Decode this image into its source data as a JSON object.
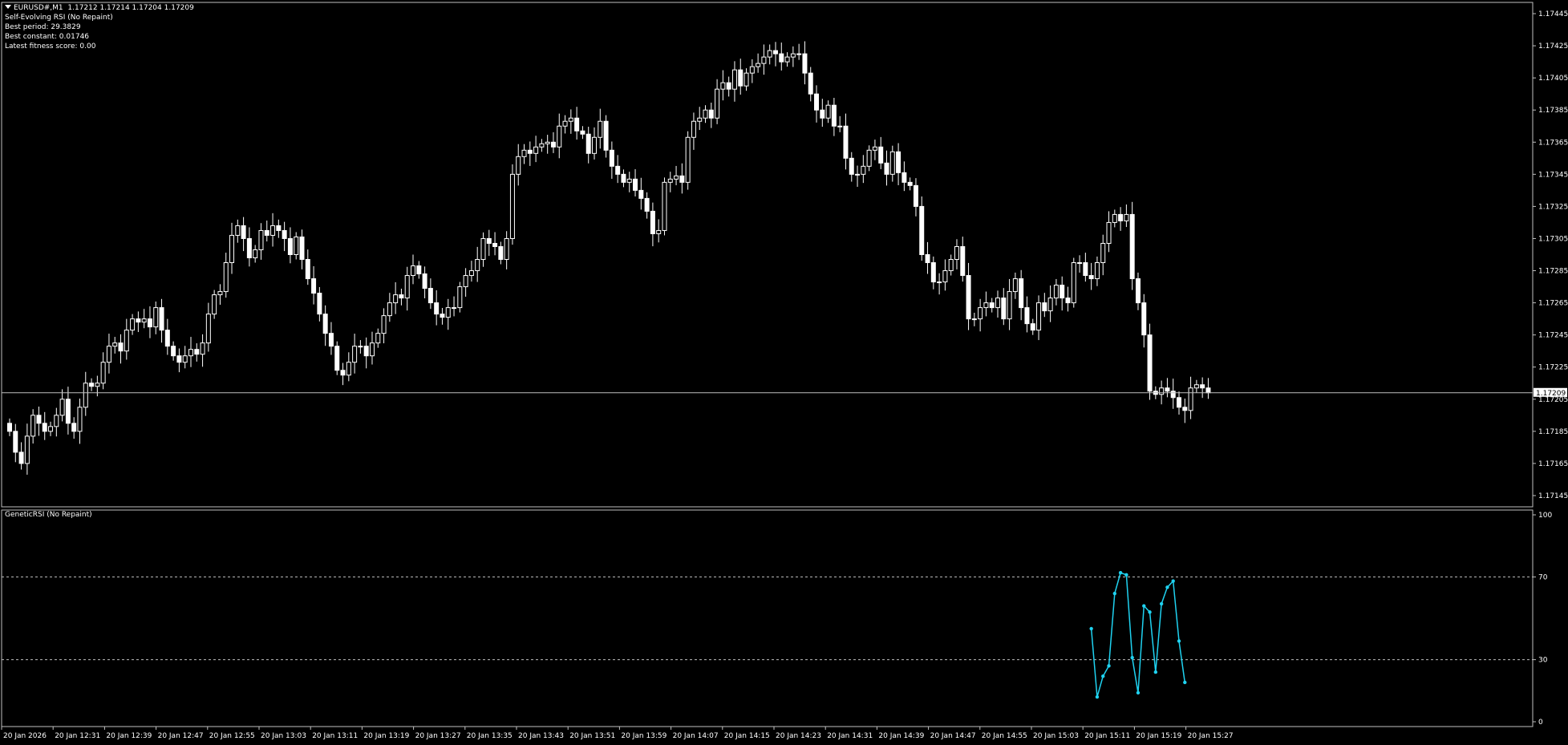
{
  "header": {
    "symbol": "EURUSD#,M1",
    "ohlc": "1.17212 1.17214 1.17204 1.17209",
    "indicator": "Self-Evolving RSI (No Repaint)",
    "best_period": "Best period: 29.3829",
    "best_constant": "Best constant: 0.01746",
    "fitness": "Latest fitness score: 0.00"
  },
  "subwindow": {
    "title": "GeneticRSI (No Repaint)"
  },
  "colors": {
    "background": "#000000",
    "bull": "#ffffff",
    "bear": "#ffffff",
    "indicator_line": "#1fd2f0",
    "level": "#c0c0c0"
  },
  "price_axis": {
    "min": 1.1714,
    "max": 1.1745,
    "ticks": [
      "1.17445",
      "1.17425",
      "1.17405",
      "1.17385",
      "1.17365",
      "1.17345",
      "1.17325",
      "1.17305",
      "1.17285",
      "1.17265",
      "1.17245",
      "1.17225",
      "1.17205",
      "1.17185",
      "1.17165",
      "1.17145"
    ],
    "current_price": "1.17209"
  },
  "time_axis": {
    "labels": [
      "20 Jan 2026",
      "20 Jan 12:31",
      "20 Jan 12:39",
      "20 Jan 12:47",
      "20 Jan 12:55",
      "20 Jan 13:03",
      "20 Jan 13:11",
      "20 Jan 13:19",
      "20 Jan 13:27",
      "20 Jan 13:35",
      "20 Jan 13:43",
      "20 Jan 13:51",
      "20 Jan 13:59",
      "20 Jan 14:07",
      "20 Jan 14:15",
      "20 Jan 14:23",
      "20 Jan 14:31",
      "20 Jan 14:39",
      "20 Jan 14:47",
      "20 Jan 14:55",
      "20 Jan 15:03",
      "20 Jan 15:11",
      "20 Jan 15:19",
      "20 Jan 15:27"
    ]
  },
  "indicator_axis": {
    "min": 0,
    "max": 100,
    "ticks": [
      "100",
      "70",
      "30",
      "0"
    ],
    "levels": [
      70,
      30
    ]
  },
  "chart_data": {
    "type": "candlestick",
    "closes": [
      1.17185,
      1.17172,
      1.17165,
      1.17182,
      1.17195,
      1.1719,
      1.17185,
      1.17188,
      1.17195,
      1.17205,
      1.1719,
      1.17185,
      1.172,
      1.17215,
      1.17213,
      1.17215,
      1.17228,
      1.17238,
      1.1724,
      1.17235,
      1.17248,
      1.17255,
      1.17253,
      1.17255,
      1.1725,
      1.17262,
      1.17248,
      1.17238,
      1.17232,
      1.17228,
      1.17232,
      1.17236,
      1.17233,
      1.1724,
      1.17258,
      1.1727,
      1.17272,
      1.1729,
      1.17307,
      1.17313,
      1.17305,
      1.17293,
      1.17298,
      1.1731,
      1.17307,
      1.17313,
      1.1731,
      1.17305,
      1.17295,
      1.17306,
      1.17292,
      1.1728,
      1.17271,
      1.17258,
      1.17246,
      1.17238,
      1.17223,
      1.1722,
      1.17228,
      1.17238,
      1.17238,
      1.17232,
      1.1724,
      1.17246,
      1.17257,
      1.17265,
      1.1727,
      1.17268,
      1.17282,
      1.17288,
      1.17283,
      1.17274,
      1.17265,
      1.17258,
      1.17256,
      1.17262,
      1.17262,
      1.17275,
      1.17282,
      1.17285,
      1.17292,
      1.17305,
      1.17302,
      1.173,
      1.17292,
      1.17305,
      1.17345,
      1.17356,
      1.1736,
      1.17358,
      1.17362,
      1.17364,
      1.17365,
      1.17362,
      1.17375,
      1.17378,
      1.1738,
      1.17372,
      1.1737,
      1.17358,
      1.17368,
      1.17378,
      1.1736,
      1.1735,
      1.17345,
      1.1734,
      1.17342,
      1.17335,
      1.1733,
      1.17322,
      1.17308,
      1.1731,
      1.1734,
      1.17342,
      1.17344,
      1.1734,
      1.17368,
      1.17378,
      1.1738,
      1.17385,
      1.1738,
      1.17398,
      1.17402,
      1.17398,
      1.1741,
      1.174,
      1.17408,
      1.17412,
      1.17414,
      1.17418,
      1.17422,
      1.1742,
      1.17415,
      1.17418,
      1.1742,
      1.1742,
      1.17408,
      1.17395,
      1.17385,
      1.1738,
      1.17388,
      1.17375,
      1.17375,
      1.17355,
      1.17345,
      1.17345,
      1.1735,
      1.1736,
      1.17362,
      1.17352,
      1.17345,
      1.17359,
      1.17346,
      1.1734,
      1.17338,
      1.17325,
      1.17295,
      1.1729,
      1.17278,
      1.17278,
      1.17285,
      1.17292,
      1.173,
      1.17282,
      1.17255,
      1.17255,
      1.17262,
      1.17265,
      1.17262,
      1.17268,
      1.17255,
      1.17272,
      1.1728,
      1.17262,
      1.17252,
      1.17248,
      1.17265,
      1.1726,
      1.17268,
      1.17276,
      1.17268,
      1.17265,
      1.1729,
      1.1729,
      1.17282,
      1.1728,
      1.1729,
      1.17302,
      1.17315,
      1.1732,
      1.17316,
      1.1732,
      1.1728,
      1.17265,
      1.17245,
      1.1721,
      1.17208,
      1.17212,
      1.1721,
      1.17206,
      1.172,
      1.17198,
      1.17212,
      1.17214,
      1.17212,
      1.17209
    ],
    "rsi_x_index": [
      185,
      186,
      187,
      188,
      189,
      190,
      191,
      192,
      193,
      194,
      195,
      196,
      197,
      198,
      199,
      200,
      201
    ],
    "rsi": [
      45,
      12,
      22,
      27,
      62,
      72,
      71,
      31,
      14,
      56,
      53,
      24,
      57,
      65,
      68,
      39,
      19
    ],
    "ylim": [
      1.1714,
      1.1745
    ]
  }
}
